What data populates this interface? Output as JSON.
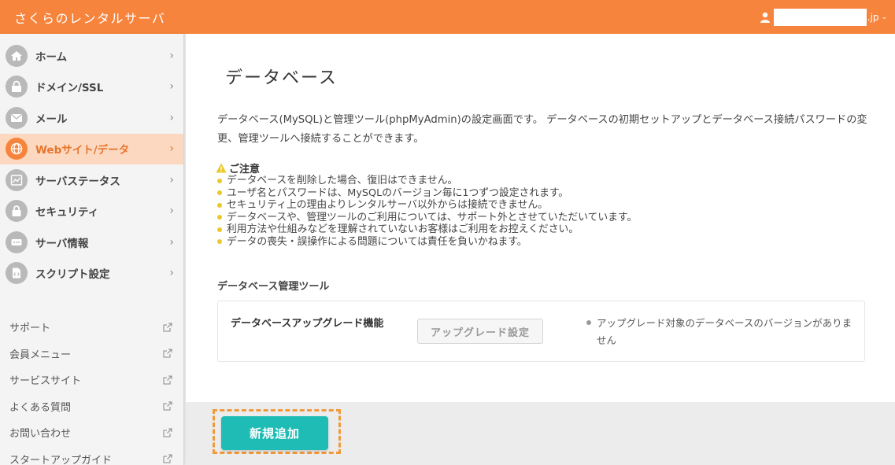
{
  "header": {
    "brand": "さくらのレンタルサーバ",
    "account_suffix": ".jp",
    "caret": "⌄"
  },
  "sidebar": {
    "nav_items": [
      {
        "label": "ホーム",
        "icon": "home-icon",
        "active": false
      },
      {
        "label": "ドメイン/SSL",
        "icon": "domain-lock-icon",
        "active": false
      },
      {
        "label": "メール",
        "icon": "mail-icon",
        "active": false
      },
      {
        "label": "Webサイト/データ",
        "icon": "globe-icon",
        "active": true
      },
      {
        "label": "サーバステータス",
        "icon": "chart-icon",
        "active": false
      },
      {
        "label": "セキュリティ",
        "icon": "lock-icon",
        "active": false
      },
      {
        "label": "サーバ情報",
        "icon": "server-icon",
        "active": false
      },
      {
        "label": "スクリプト設定",
        "icon": "script-icon",
        "active": false
      }
    ],
    "chevron": "›",
    "sub_links": [
      {
        "label": "サポート"
      },
      {
        "label": "会員メニュー"
      },
      {
        "label": "サービスサイト"
      },
      {
        "label": "よくある質問"
      },
      {
        "label": "お問い合わせ"
      },
      {
        "label": "スタートアップガイド"
      }
    ]
  },
  "main": {
    "title": "データベース",
    "intro": "データベース(MySQL)と管理ツール(phpMyAdmin)の設定画面です。 データベースの初期セットアップとデータベース接続パスワードの変更、管理ツールへ接続することができます。",
    "notice_title": "ご注意",
    "notices": [
      "データベースを削除した場合、復旧はできません。",
      "ユーザ名とパスワードは、MySQLのバージョン毎に1つずつ設定されます。",
      "セキュリティ上の理由よりレンタルサーバ以外からは接続できません。",
      "データベースや、管理ツールのご利用については、サポート外とさせていただいています。",
      "利用方法や仕組みなどを理解されていないお客様はご利用をお控えください。",
      "データの喪失・誤操作による問題については責任を負いかねます。"
    ],
    "section_title": "データベース管理ツール",
    "tool": {
      "name": "データベースアップグレード機能",
      "button_label": "アップグレード設定",
      "note": "アップグレード対象のデータベースのバージョンがありません"
    },
    "add_button_label": "新規追加"
  },
  "colors": {
    "header": "#f7843c",
    "active_bg": "#fbd8bf",
    "accent": "#e6762e",
    "add_button": "#1ebcb4",
    "highlight": "#f09a3c",
    "warning": "#e8c82a"
  }
}
